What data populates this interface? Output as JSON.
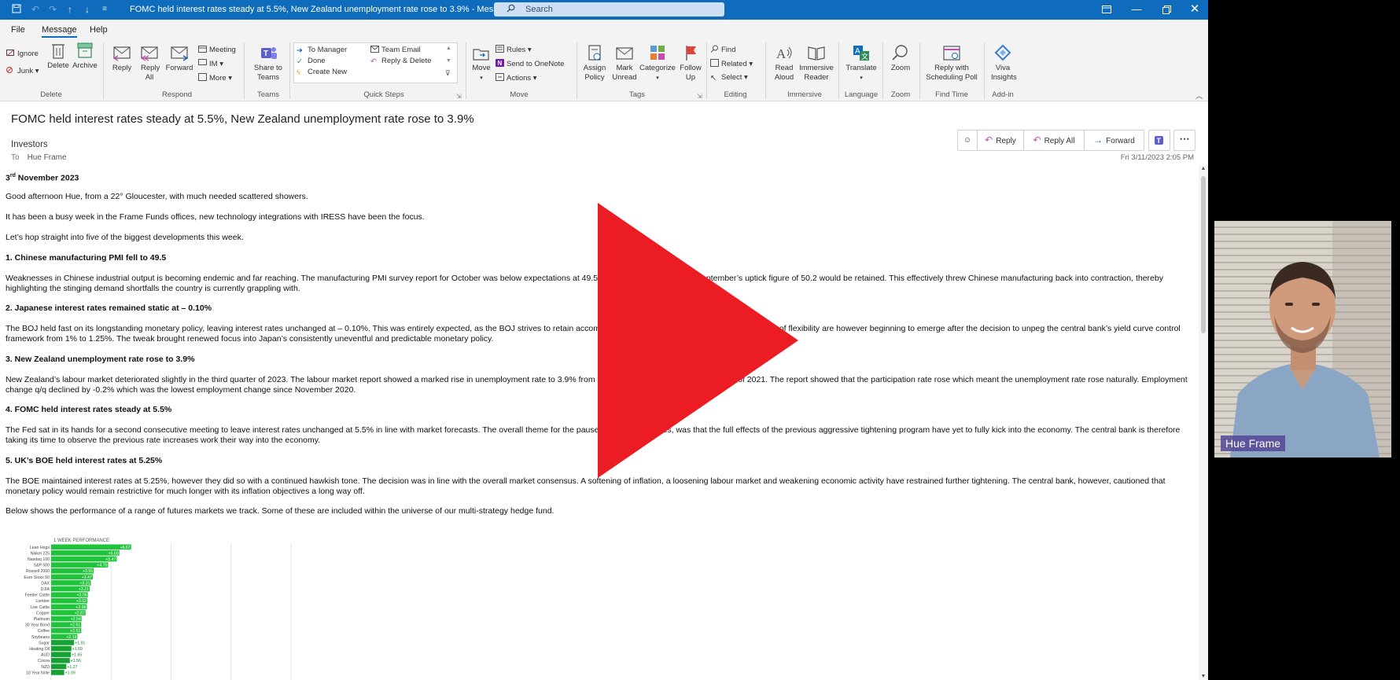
{
  "window": {
    "title": "FOMC held interest rates steady at 5.5%, New Zealand unemployment rate rose to 3.9%  -  Message (HT...",
    "search_placeholder": "Search"
  },
  "menu": {
    "tabs": [
      "File",
      "Message",
      "Help"
    ],
    "active": "Message"
  },
  "ribbon": {
    "delete": {
      "ignore": "Ignore",
      "junk": "Junk",
      "delete": "Delete",
      "archive": "Archive",
      "label": "Delete"
    },
    "respond": {
      "reply": "Reply",
      "reply_all": "Reply All",
      "forward": "Forward",
      "meeting": "Meeting",
      "im": "IM",
      "more": "More",
      "label": "Respond"
    },
    "teams": {
      "share": "Share to Teams",
      "label": "Teams"
    },
    "quick_steps": {
      "items": [
        "To Manager",
        "Team Email",
        "Done",
        "Reply & Delete",
        "Create New"
      ],
      "label": "Quick Steps"
    },
    "move": {
      "move": "Move",
      "rules": "Rules",
      "onenote": "Send to OneNote",
      "actions": "Actions",
      "label": "Move"
    },
    "tags": {
      "assign_policy": "Assign Policy",
      "mark_unread": "Mark Unread",
      "categorize": "Categorize",
      "follow_up": "Follow Up",
      "label": "Tags"
    },
    "editing": {
      "find": "Find",
      "related": "Related",
      "select": "Select",
      "label": "Editing"
    },
    "immersive": {
      "read_aloud": "Read Aloud",
      "immersive_reader": "Immersive Reader",
      "label": "Immersive"
    },
    "language": {
      "translate": "Translate",
      "label": "Language"
    },
    "zoom": {
      "zoom": "Zoom",
      "label": "Zoom"
    },
    "find_time": {
      "reply_poll": "Reply with Scheduling Poll",
      "label": "Find Time"
    },
    "addin": {
      "viva": "Viva Insights",
      "label": "Add-in"
    }
  },
  "email": {
    "subject": "FOMC held interest rates steady at 5.5%, New Zealand unemployment rate rose to 3.9%",
    "from": "Investors",
    "to_label": "To",
    "to": "Hue Frame",
    "date": "Fri 3/11/2023 2:05 PM",
    "actions": {
      "reply": "Reply",
      "reply_all": "Reply All",
      "forward": "Forward"
    },
    "date_line_day": "3",
    "date_line_sup": "rd",
    "date_line_rest": " November 2023",
    "paragraphs": [
      "Good afternoon Hue, from a 22° Gloucester, with much needed scattered showers.",
      "It has been a busy week in the Frame Funds offices, new technology integrations with IRESS have been the focus.",
      "Let’s hop straight into five of the biggest developments this week.",
      "1. Chinese manufacturing PMI fell to 49.5",
      "Weaknesses in Chinese industrial output is becoming endemic and far reaching. The manufacturing PMI survey report for October was below expectations at 49.5, against expectations that September’s uptick figure of 50.2 would be retained. This effectively threw Chinese manufacturing back into contraction, thereby highlighting the stinging demand shortfalls the country is currently grappling with.",
      "2. Japanese interest rates remained static at – 0.10%",
      "The BOJ held fast on its longstanding monetary policy, leaving interest rates unchanged at – 0.10%. This was entirely expected, as the BOJ strives to retain accommodative conditions for the economy. Tacit signs of flexibility are however beginning to emerge after the decision to unpeg the central bank’s yield curve control framework from 1% to 1.25%. The tweak brought renewed focus into Japan’s consistently uneventful and predictable monetary policy.",
      "3. New Zealand unemployment rate rose to 3.9%",
      "New Zealand’s labour market deteriorated slightly in the third quarter of 2023. The labour market report showed a marked rise in unemployment rate to 3.9% from the prior quarter, the highest since Q2 of 2021. The report showed that the participation rate rose which meant the unemployment rate rose naturally. Employment change q/q declined by -0.2% which was the lowest employment change since November 2020.",
      "4. FOMC held interest rates steady at 5.5%",
      "The Fed sat in its hands for a second consecutive meeting to leave interest rates unchanged at 5.5% in line with market forecasts. The overall theme for the pause, as per the minutes, was that the full effects of the previous aggressive tightening program have yet to fully kick into the economy. The central bank is therefore taking its time to observe the previous rate increases work their way into the economy.",
      "5. UK’s BOE held interest rates at 5.25%",
      "The BOE maintained interest rates at 5.25%, however they did so with a continued hawkish tone. The decision was in line with the overall market consensus. A softening of inflation, a loosening labour market and weakening economic activity have restrained further tightening. The central bank, however, cautioned that monetary policy would remain restrictive for much longer with its inflation objectives a long way off.",
      "Below shows the performance of a range of futures markets we track. Some of these are included within the universe of our multi-strategy hedge fund."
    ]
  },
  "webcam": {
    "name": "Hue Frame"
  },
  "colors": {
    "titlebar": "#0f6cbd",
    "play": "#ec1c24",
    "bar": "#1fc43a"
  },
  "chart_data": {
    "type": "bar",
    "orientation": "horizontal",
    "title": "1 WEEK PERFORMANCE",
    "categories": [
      "Lean Hogs",
      "Nikkei 225",
      "Nasdaq 100",
      "S&P 500",
      "Russell 2000",
      "Euro Stoxx 50",
      "DAX",
      "DJIA",
      "Feeder Cattle",
      "Lumber",
      "Live Cattle",
      "Copper",
      "Platinum",
      "30 Year Bond",
      "Coffee",
      "Soybeans",
      "Sugar",
      "Heating Oil",
      "AUD",
      "Cocoa",
      "NZD",
      "10 Year Note"
    ],
    "values": [
      6.67,
      5.69,
      5.47,
      4.75,
      3.55,
      3.47,
      3.31,
      3.21,
      3.06,
      3.02,
      2.98,
      2.87,
      2.54,
      2.51,
      2.51,
      2.19,
      1.91,
      1.69,
      1.65,
      1.56,
      1.27,
      1.09
    ],
    "value_labels": [
      "+6.67",
      "+5.69",
      "+5.47",
      "+4.75",
      "+3.55",
      "+3.47",
      "+3.31",
      "+3.21",
      "+3.06",
      "+3.02",
      "+2.98",
      "+2.87",
      "+2.54",
      "+2.51",
      "+2.51",
      "+2.19",
      "+1.91",
      "+1.69",
      "+1.65",
      "+1.56",
      "+1.27",
      "+1.09"
    ],
    "xlim": [
      0,
      20
    ],
    "grid": true
  }
}
